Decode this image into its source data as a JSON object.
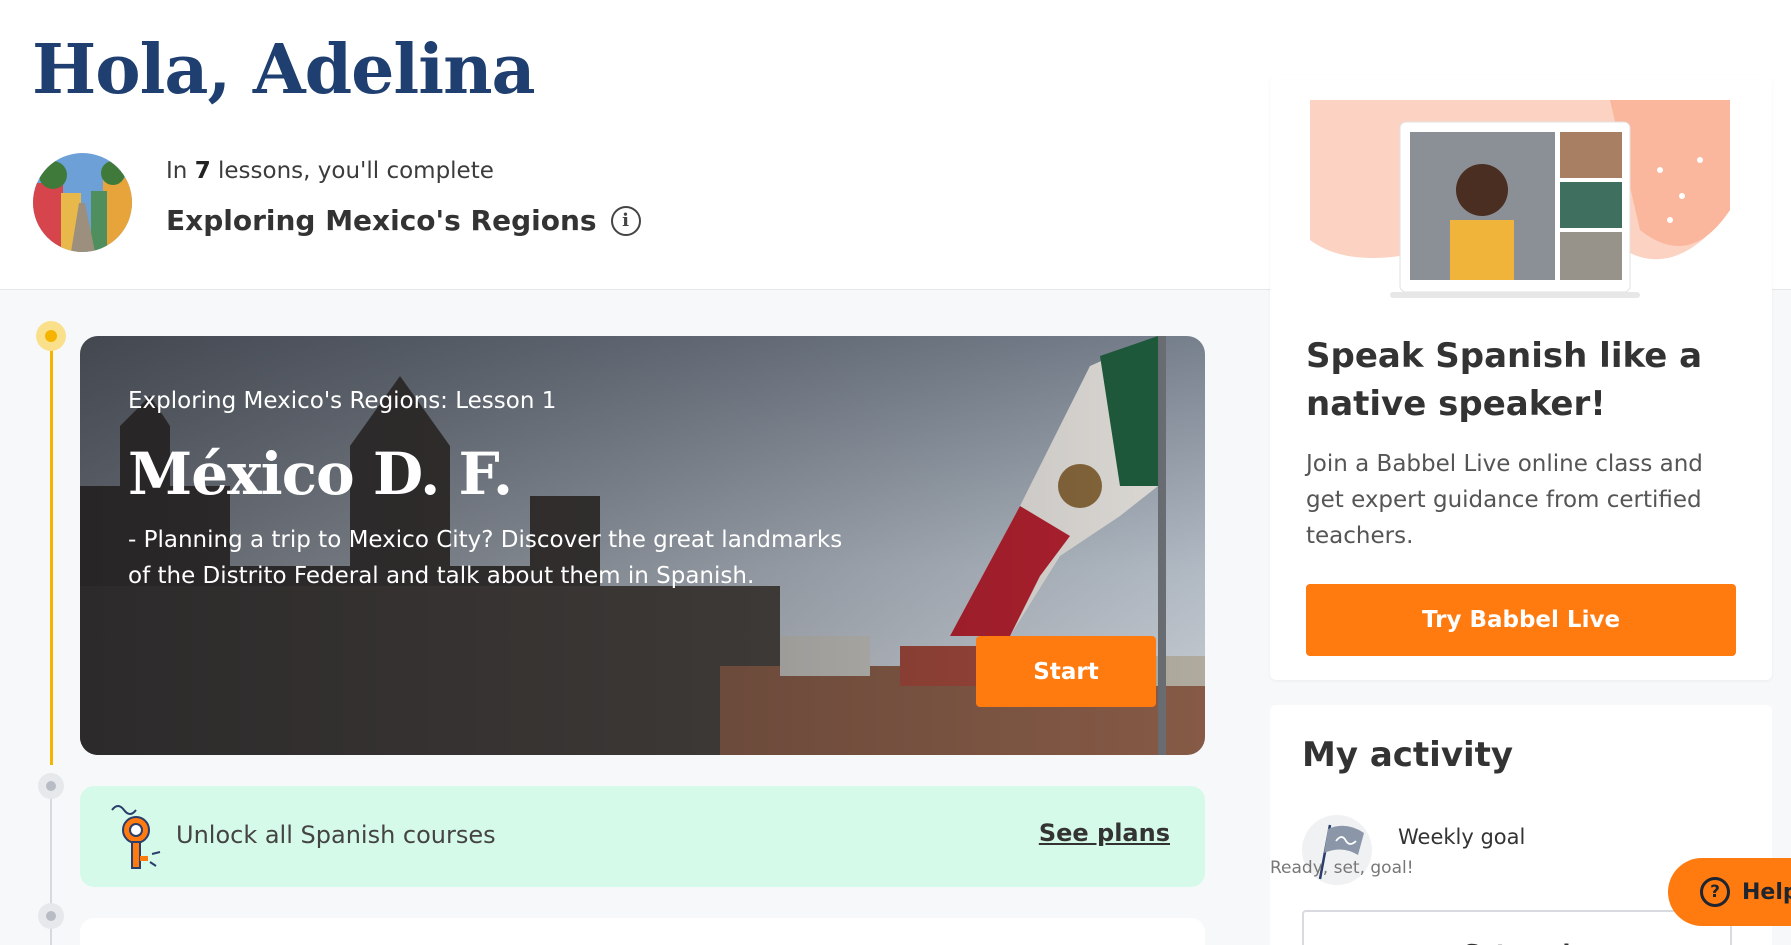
{
  "header": {
    "greeting": "Hola, Adelina",
    "progress_prefix": "In",
    "progress_count": "7",
    "progress_suffix": "lessons, you'll complete",
    "course_title": "Exploring Mexico's Regions"
  },
  "lesson": {
    "kicker": "Exploring Mexico's Regions: Lesson 1",
    "title": "México D. F.",
    "description": "- Planning a trip to Mexico City? Discover the great landmarks of the Distrito Federal and talk about them in Spanish.",
    "start_label": "Start"
  },
  "unlock": {
    "text": "Unlock all Spanish courses",
    "link_label": "See plans"
  },
  "promo": {
    "title": "Speak Spanish like a native speaker!",
    "description": "Join a Babbel Live online class and get expert guidance from certified teachers.",
    "button_label": "Try Babbel Live"
  },
  "activity": {
    "title": "My activity",
    "goal_label": "Weekly goal",
    "goal_sub": "Ready, set, goal!",
    "set_goal_label": "Set goal"
  },
  "help": {
    "label": "Help"
  },
  "colors": {
    "accent_orange": "#ff7a0f",
    "heading_navy": "#1f3f70",
    "timeline_yellow": "#f5b400",
    "unlock_mint": "#d6fae9"
  }
}
